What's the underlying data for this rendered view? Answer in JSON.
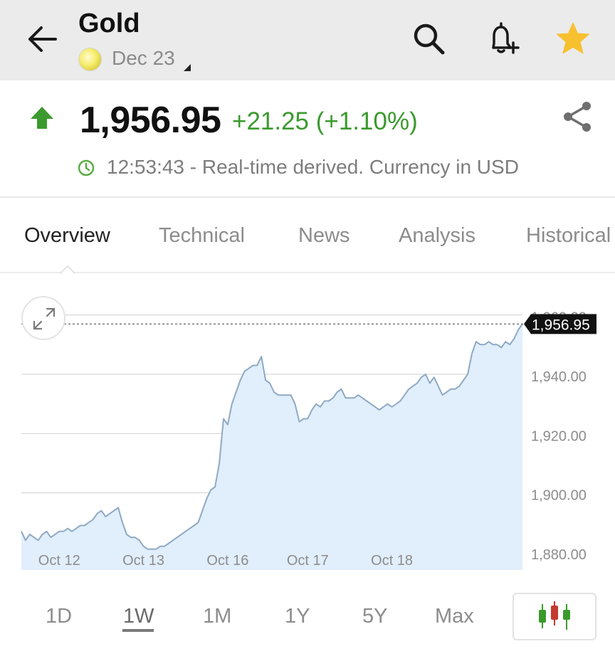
{
  "header": {
    "back_icon": "arrow-left-icon",
    "title": "Gold",
    "contract": "Dec 23",
    "actions": [
      "search-icon",
      "bell-plus-icon",
      "star-icon"
    ],
    "star_color": "#f7c02f"
  },
  "quote": {
    "direction_icon": "arrow-up-icon",
    "price": "1,956.95",
    "change": "+21.25 (+1.10%)",
    "change_color": "#3b9a2e",
    "time_note": "12:53:43 - Real-time derived. Currency in USD",
    "share_icon": "share-icon"
  },
  "tabs": [
    {
      "label": "Overview",
      "active": true
    },
    {
      "label": "Technical",
      "active": false
    },
    {
      "label": "News",
      "active": false
    },
    {
      "label": "Analysis",
      "active": false
    },
    {
      "label": "Historical",
      "active": false
    }
  ],
  "chart_data": {
    "type": "area",
    "y_tick_labels": [
      "1,960.00",
      "1,940.00",
      "1,920.00",
      "1,900.00",
      "1,880.00"
    ],
    "y_ticks": [
      1960,
      1940,
      1920,
      1900,
      1880
    ],
    "ylim": [
      1874,
      1964
    ],
    "x_tick_labels": [
      "Oct 12",
      "Oct 13",
      "Oct 16",
      "Oct 17",
      "Oct 18"
    ],
    "x_tick_positions": [
      9,
      29,
      49,
      68,
      88
    ],
    "current_value_label": "1,956.95",
    "current_value": 1956.95,
    "line_color": "#8fa9c4",
    "fill_color": "#e1eefb",
    "values": [
      1887,
      1884,
      1886,
      1885,
      1884,
      1886,
      1887,
      1885,
      1886,
      1887,
      1887,
      1888,
      1887,
      1888,
      1889,
      1889,
      1890,
      1891,
      1893,
      1894,
      1892,
      1893,
      1894,
      1895,
      1890,
      1886,
      1885,
      1885,
      1884,
      1882,
      1881,
      1881,
      1881,
      1882,
      1882,
      1883,
      1884,
      1885,
      1886,
      1887,
      1888,
      1889,
      1890,
      1894,
      1898,
      1901,
      1902,
      1910,
      1925,
      1923,
      1930,
      1934,
      1938,
      1941,
      1942,
      1943,
      1943,
      1946,
      1938,
      1937,
      1934,
      1933,
      1933,
      1933,
      1933,
      1930,
      1924,
      1925,
      1925,
      1928,
      1930,
      1929,
      1931,
      1931,
      1932,
      1934,
      1935,
      1932,
      1932,
      1932,
      1933,
      1932,
      1931,
      1930,
      1929,
      1928,
      1929,
      1930,
      1929,
      1930,
      1931,
      1933,
      1935,
      1936,
      1937,
      1939,
      1940,
      1937,
      1939,
      1936,
      1933,
      1934,
      1935,
      1935,
      1936,
      1938,
      1940,
      1947,
      1951,
      1950,
      1950,
      1951,
      1950,
      1950,
      1949,
      1951,
      1950,
      1952,
      1955,
      1957
    ]
  },
  "ranges": [
    {
      "label": "1D",
      "active": false
    },
    {
      "label": "1W",
      "active": true
    },
    {
      "label": "1M",
      "active": false
    },
    {
      "label": "1Y",
      "active": false
    },
    {
      "label": "5Y",
      "active": false
    },
    {
      "label": "Max",
      "active": false
    }
  ],
  "chart_type_icon": "candlestick-icon",
  "expand_icon": "expand-icon"
}
